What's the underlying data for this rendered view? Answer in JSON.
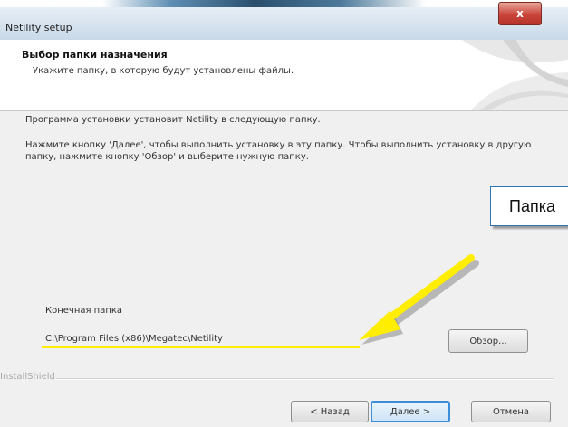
{
  "window": {
    "title": "Netility setup",
    "close_label": "x"
  },
  "header": {
    "title": "Выбор папки назначения",
    "subtitle": "Укажите папку, в которую будут установлены файлы."
  },
  "content": {
    "intro": "Программа установки установит Netility в следующую папку.",
    "instructions": "Нажмите кнопку 'Далее', чтобы выполнить установку в эту папку. Чтобы выполнить установку в другую папку, нажмите кнопку 'Обзор' и выберите нужную папку."
  },
  "destination": {
    "label": "Конечная папка",
    "path": "C:\\Program Files (x86)\\Megatec\\Netility",
    "browse_label": "Обзор..."
  },
  "callout": {
    "text": "Папка"
  },
  "footer": {
    "brand": "InstallShield",
    "back_label": "< Назад",
    "next_label": "Далее >",
    "cancel_label": "Отмена"
  },
  "colors": {
    "arrow": "#ffee00",
    "callout_border": "#2e75b6",
    "default_button_border": "#3c8ed8"
  }
}
